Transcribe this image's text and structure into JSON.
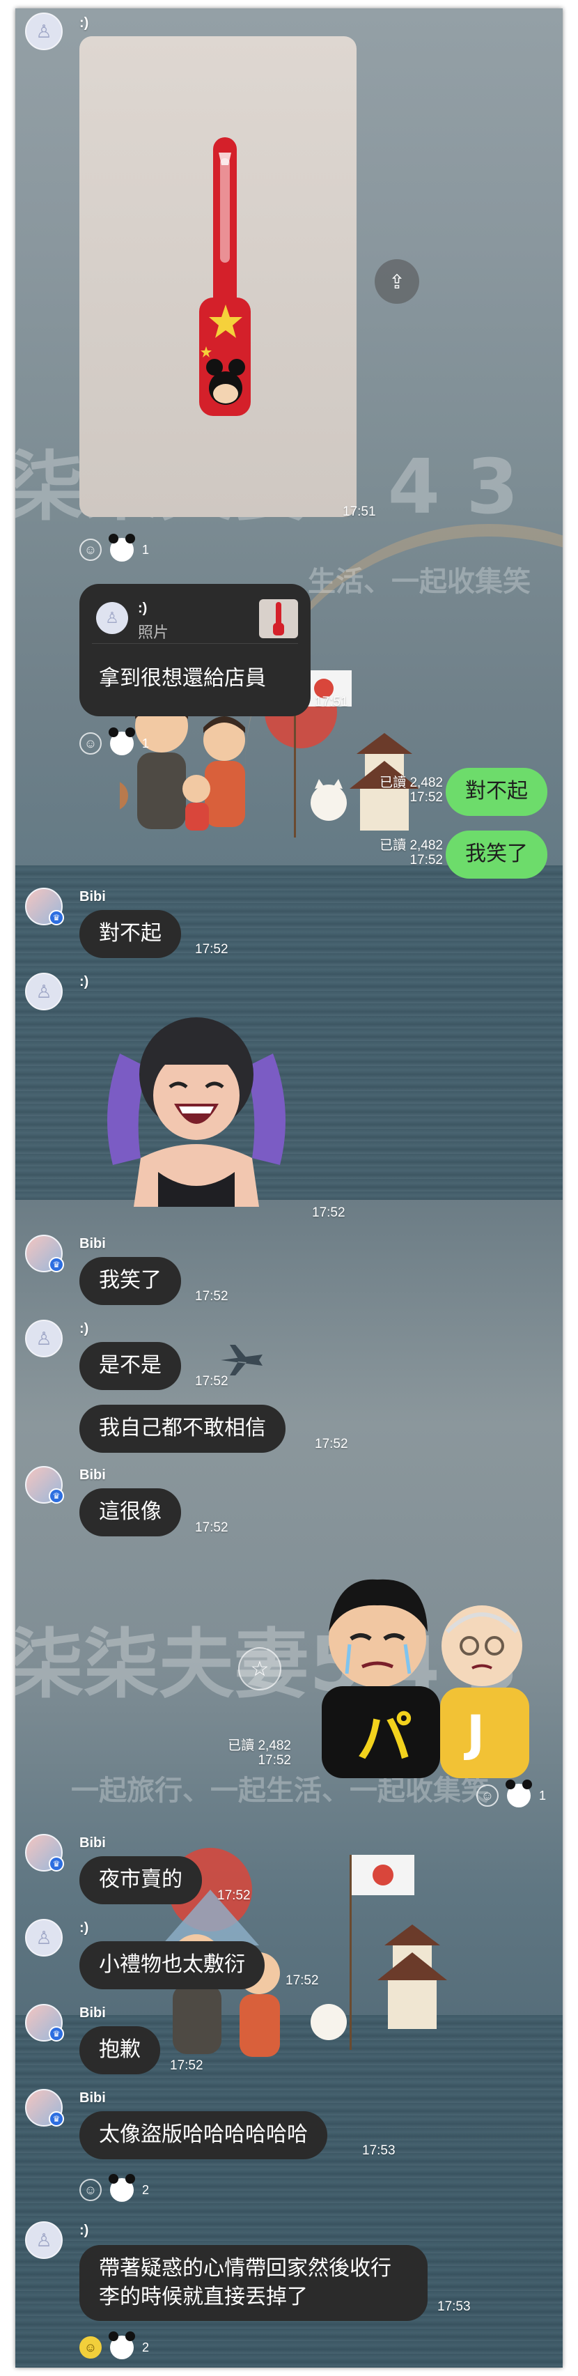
{
  "app": {
    "accent_bubble_color": "#6ddc6b",
    "dark_bubble_color": "#2b2b2b"
  },
  "watermarks": {
    "top_brand": "柒柒夫妻5 4 3",
    "top_slogan": "生活、一起收集笑",
    "mid_brand": "柒柒夫妻5 4 3",
    "mid_slogan": "一起旅行、一起生活、一起收集笑"
  },
  "messages": [
    {
      "sender": ":)",
      "kind": "photo",
      "time": "17:51",
      "reaction_count": "1"
    },
    {
      "sender": ":)",
      "kind": "reply",
      "reply_to_name": ":)",
      "reply_to_type": "照片",
      "text": "拿到很想還給店員",
      "time": "17:51",
      "reaction_count": "1"
    },
    {
      "sender": "me",
      "text": "對不起",
      "read": "已讀 2,482",
      "time": "17:52"
    },
    {
      "sender": "me",
      "text": "我笑了",
      "read": "已讀 2,482",
      "time": "17:52"
    },
    {
      "sender": "Bibi",
      "text": "對不起",
      "time": "17:52"
    },
    {
      "sender": ":)",
      "kind": "sticker",
      "sticker_icon": "laughing-girl-sticker",
      "time": "17:52"
    },
    {
      "sender": "Bibi",
      "text": "我笑了",
      "time": "17:52"
    },
    {
      "sender": ":)",
      "text": "是不是",
      "time": "17:52"
    },
    {
      "sender": ":)",
      "text": "我自己都不敢相信",
      "time": "17:52"
    },
    {
      "sender": "Bibi",
      "text": "這很像",
      "time": "17:52"
    },
    {
      "sender": "me",
      "kind": "sticker",
      "sticker_icon": "crying-men-sticker",
      "read": "已讀 2,482",
      "time": "17:52",
      "reaction_count": "1"
    },
    {
      "sender": "Bibi",
      "text": "夜市賣的",
      "time": "17:52"
    },
    {
      "sender": ":)",
      "text": "小禮物也太敷衍",
      "time": "17:52"
    },
    {
      "sender": "Bibi",
      "text": "抱歉",
      "time": "17:52"
    },
    {
      "sender": "Bibi",
      "text": "太像盜版哈哈哈哈哈哈",
      "time": "17:53",
      "reaction_count": "2"
    },
    {
      "sender": ":)",
      "text": "帶著疑惑的心情帶回家然後收行李的時候就直接丟掉了",
      "time": "17:53",
      "reaction_count": "2"
    }
  ],
  "labels": {
    "sender_smile": ":)",
    "sender_bibi": "Bibi"
  }
}
